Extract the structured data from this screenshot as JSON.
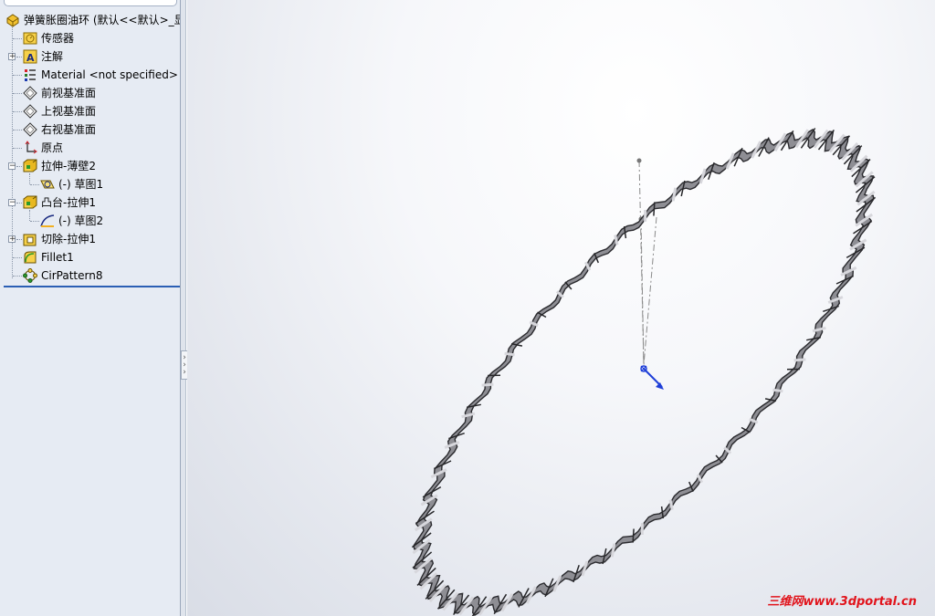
{
  "feature_tree": {
    "part_name": "弹簧胀圈油环 (默认<<默认>_显",
    "items": [
      {
        "label": "传感器",
        "icon": "sensor-icon",
        "expandable": false
      },
      {
        "label": "注解",
        "icon": "annotation-icon",
        "expandable": true
      },
      {
        "label": "Material <not specified>",
        "icon": "material-icon",
        "expandable": false
      },
      {
        "label": "前视基准面",
        "icon": "plane-icon",
        "expandable": false
      },
      {
        "label": "上视基准面",
        "icon": "plane-icon",
        "expandable": false
      },
      {
        "label": "右视基准面",
        "icon": "plane-icon",
        "expandable": false
      },
      {
        "label": "原点",
        "icon": "origin-icon",
        "expandable": false
      },
      {
        "label": "拉伸-薄壁2",
        "icon": "extrude-icon",
        "expandable": true,
        "expanded": true
      },
      {
        "label": "(-) 草图1",
        "icon": "sketch-icon",
        "child": true
      },
      {
        "label": "凸台-拉伸1",
        "icon": "extrude-icon",
        "expandable": true,
        "expanded": true
      },
      {
        "label": "(-) 草图2",
        "icon": "sketch-icon",
        "child": true
      },
      {
        "label": "切除-拉伸1",
        "icon": "cut-extrude-icon",
        "expandable": true
      },
      {
        "label": "Fillet1",
        "icon": "fillet-icon",
        "expandable": false
      },
      {
        "label": "CirPattern8",
        "icon": "circular-pattern-icon",
        "expandable": false
      }
    ]
  },
  "viewport": {
    "model": "spring-expander-oil-ring",
    "watermark": "三维网www.3dportal.cn"
  },
  "colors": {
    "tree_background": "#e6ebf3",
    "rollback_bar": "#2b5fb4",
    "ring_fill": "#8e8e94",
    "ring_edge": "#2a2a2e",
    "triad": "#1f3fd8",
    "watermark": "#e1141c"
  }
}
